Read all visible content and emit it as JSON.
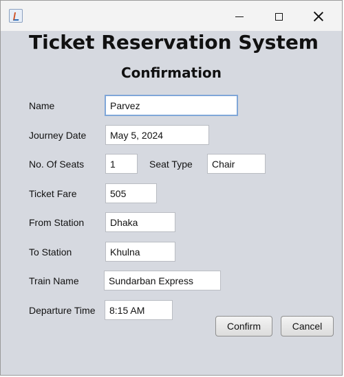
{
  "titlebar": {
    "app_icon": "java-icon",
    "minimize_icon": "minimize-icon",
    "maximize_icon": "maximize-icon",
    "close_icon": "close-icon"
  },
  "heading": {
    "title": "Ticket Reservation System",
    "subtitle": "Confirmation"
  },
  "form": {
    "name": {
      "label": "Name",
      "value": "Parvez"
    },
    "journey_date": {
      "label": "Journey Date",
      "value": "May 5, 2024"
    },
    "seats": {
      "label": "No. Of Seats",
      "value": "1"
    },
    "seat_type": {
      "label": "Seat Type",
      "value": "Chair"
    },
    "ticket_fare": {
      "label": "Ticket Fare",
      "value": "505"
    },
    "from_station": {
      "label": "From Station",
      "value": "Dhaka"
    },
    "to_station": {
      "label": "To Station",
      "value": "Khulna"
    },
    "train_name": {
      "label": "Train Name",
      "value": "Sundarban Express"
    },
    "departure_time": {
      "label": "Departure Time",
      "value": "8:15 AM"
    }
  },
  "buttons": {
    "confirm": "Confirm",
    "cancel": "Cancel"
  }
}
